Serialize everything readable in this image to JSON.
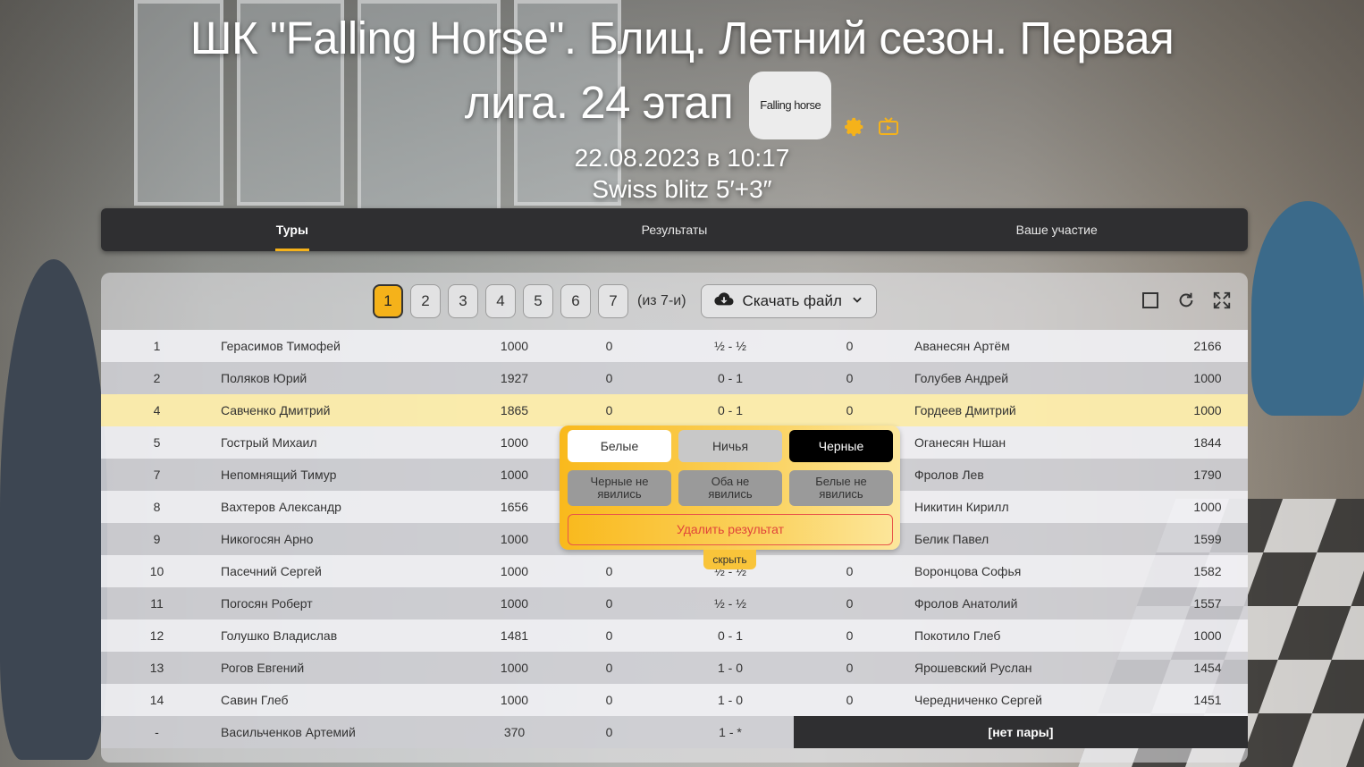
{
  "header": {
    "title_line1": "ШК \"Falling Horse\". Блиц. Летний сезон. Первая",
    "title_line2": "лига. 24 этап",
    "club_badge": "Falling horse",
    "date": "22.08.2023 в 10:17",
    "format": "Swiss blitz 5′+3″",
    "icons": [
      "gear-icon",
      "tv-icon"
    ]
  },
  "tabs": [
    {
      "label": "Туры",
      "active": true
    },
    {
      "label": "Результаты",
      "active": false
    },
    {
      "label": "Ваше участие",
      "active": false
    }
  ],
  "toolbar": {
    "rounds": [
      "1",
      "2",
      "3",
      "4",
      "5",
      "6",
      "7"
    ],
    "active_round": "1",
    "rounds_of": "(из 7-и)",
    "download_label": "Скачать файл",
    "icons": [
      "checkbox-icon",
      "refresh-icon",
      "fullscreen-icon"
    ]
  },
  "pairings": [
    {
      "no": "1",
      "white": "Герасимов Тимофей",
      "white_rating": "1000",
      "white_points": "0",
      "result": "½ - ½",
      "black_points": "0",
      "black": "Аванесян Артём",
      "black_rating": "2166"
    },
    {
      "no": "2",
      "white": "Поляков Юрий",
      "white_rating": "1927",
      "white_points": "0",
      "result": "0 - 1",
      "black_points": "0",
      "black": "Голубев Андрей",
      "black_rating": "1000"
    },
    {
      "no": "4",
      "white": "Савченко Дмитрий",
      "white_rating": "1865",
      "white_points": "0",
      "result": "0 - 1",
      "black_points": "0",
      "black": "Гордеев Дмитрий",
      "black_rating": "1000"
    },
    {
      "no": "5",
      "white": "Гострый Михаил",
      "white_rating": "1000",
      "white_points": "",
      "result": "",
      "black_points": "",
      "black": "Оганесян Ншан",
      "black_rating": "1844"
    },
    {
      "no": "7",
      "white": "Непомнящий Тимур",
      "white_rating": "1000",
      "white_points": "",
      "result": "",
      "black_points": "",
      "black": "Фролов Лев",
      "black_rating": "1790"
    },
    {
      "no": "8",
      "white": "Вахтеров Александр",
      "white_rating": "1656",
      "white_points": "",
      "result": "",
      "black_points": "",
      "black": "Никитин Кирилл",
      "black_rating": "1000"
    },
    {
      "no": "9",
      "white": "Никогосян Арно",
      "white_rating": "1000",
      "white_points": "",
      "result": "",
      "black_points": "",
      "black": "Белик Павел",
      "black_rating": "1599"
    },
    {
      "no": "10",
      "white": "Пасечний Сергей",
      "white_rating": "1000",
      "white_points": "0",
      "result": "½ - ½",
      "black_points": "0",
      "black": "Воронцова Софья",
      "black_rating": "1582"
    },
    {
      "no": "11",
      "white": "Погосян Роберт",
      "white_rating": "1000",
      "white_points": "0",
      "result": "½ - ½",
      "black_points": "0",
      "black": "Фролов Анатолий",
      "black_rating": "1557"
    },
    {
      "no": "12",
      "white": "Голушко Владислав",
      "white_rating": "1481",
      "white_points": "0",
      "result": "0 - 1",
      "black_points": "0",
      "black": "Покотило Глеб",
      "black_rating": "1000"
    },
    {
      "no": "13",
      "white": "Рогов Евгений",
      "white_rating": "1000",
      "white_points": "0",
      "result": "1 - 0",
      "black_points": "0",
      "black": "Ярошевский Руслан",
      "black_rating": "1454"
    },
    {
      "no": "14",
      "white": "Савин Глеб",
      "white_rating": "1000",
      "white_points": "0",
      "result": "1 - 0",
      "black_points": "0",
      "black": "Чередниченко Сергей",
      "black_rating": "1451"
    }
  ],
  "bye_row": {
    "no": "-",
    "white": "Васильченков Артемий",
    "white_rating": "370",
    "white_points": "0",
    "result": "1 - *",
    "no_pair_label": "[нет пары]"
  },
  "result_popup": {
    "white_win": "Белые",
    "draw": "Ничья",
    "black_win": "Черные",
    "black_no_show_1": "Черные не",
    "black_no_show_2": "явились",
    "both_no_show_1": "Оба не",
    "both_no_show_2": "явились",
    "white_no_show_1": "Белые не",
    "white_no_show_2": "явились",
    "delete": "Удалить результат",
    "hide": "скрыть"
  },
  "colors": {
    "accent": "#f5b21a",
    "highlight_row": "#fcecaa",
    "dark": "#2f2f31",
    "danger": "#e0453a"
  }
}
